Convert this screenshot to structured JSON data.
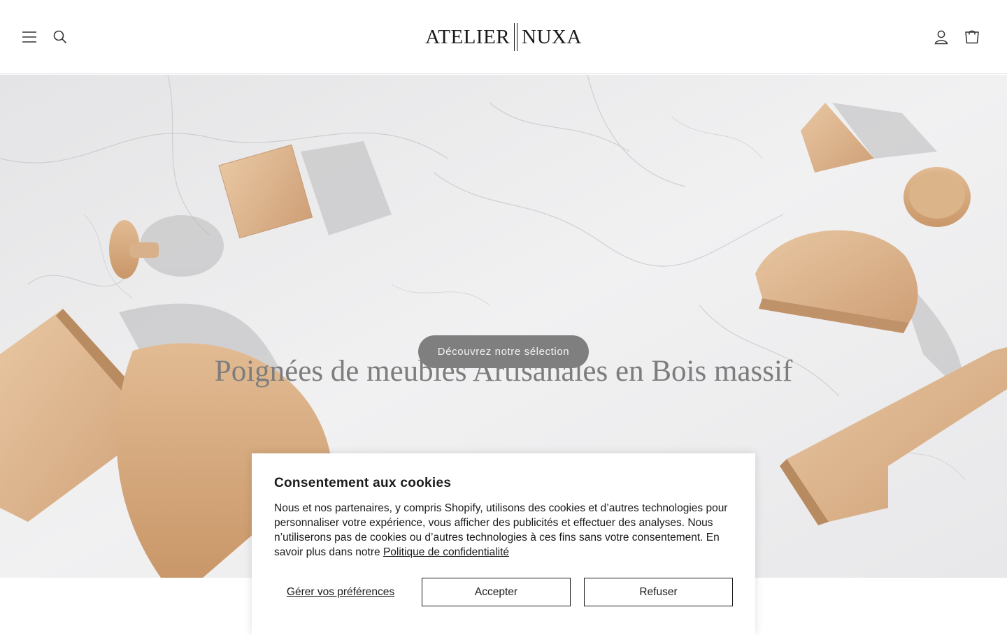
{
  "brand": {
    "logo_left": "ATELIER",
    "logo_right": "NUXA"
  },
  "header": {
    "icons": [
      "menu-icon",
      "search-icon",
      "account-icon",
      "cart-icon"
    ]
  },
  "hero": {
    "title": "Poignées de meubles Artisanales en Bois massif",
    "cta_label": "Découvrez notre sélection"
  },
  "cookie": {
    "title": "Consentement aux cookies",
    "body": "Nous et nos partenaires, y compris Shopify, utilisons des cookies et d’autres technologies pour personnaliser votre expérience, vous afficher des publicités et effectuer des analyses. Nous n’utiliserons pas de cookies ou d’autres technologies à ces fins sans votre consentement. En savoir plus dans notre ",
    "privacy_link": "Politique de confidentialité",
    "manage_label": "Gérer vos préférences",
    "accept_label": "Accepter",
    "refuse_label": "Refuser"
  },
  "colors": {
    "cta_background": "#7f7f7f",
    "wood": "#dcb48a",
    "marble": "#ededee"
  }
}
